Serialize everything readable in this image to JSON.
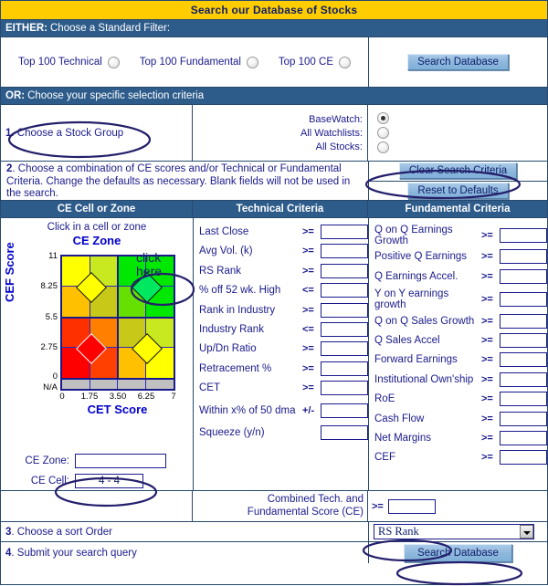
{
  "banner": {
    "title": "Search our Database of Stocks"
  },
  "standard_filter": {
    "header_bold": "EITHER:",
    "header_text": "Choose a Standard Filter:",
    "options": [
      {
        "label": "Top 100 Technical",
        "selected": false
      },
      {
        "label": "Top 100 Fundamental",
        "selected": false
      },
      {
        "label": "Top 100 CE",
        "selected": false
      }
    ],
    "search_button": "Search Database"
  },
  "specific_criteria": {
    "header_bold": "OR:",
    "header_text": "Choose your specific selection criteria"
  },
  "stock_group": {
    "step_number": "1",
    "step_text": ". Choose a Stock Group",
    "options": [
      {
        "label": "BaseWatch:",
        "selected": true
      },
      {
        "label": "All Watchlists:",
        "selected": false
      },
      {
        "label": "All Stocks:",
        "selected": false
      }
    ]
  },
  "instructions": {
    "step_number": "2",
    "step_text": ". Choose a combination of CE scores and/or Technical or Fundamental Criteria. Change the defaults as necessary. Blank fields will not be used in the search.",
    "clear_button": "Clear Search Criteria",
    "reset_button": "Reset to Defaults"
  },
  "column_headers": {
    "ce": "CE Cell or Zone",
    "technical": "Technical Criteria",
    "fundamental": "Fundamental Criteria"
  },
  "ce_panel": {
    "instruction": "Click in a cell or zone",
    "chart_title": "CE Zone",
    "y_axis_label": "CEF Score",
    "x_axis_label": "CET Score",
    "y_ticks": [
      "11",
      "8.25",
      "5.5",
      "2.75",
      "0",
      "N/A"
    ],
    "x_ticks": [
      "0",
      "1.75",
      "3.50",
      "6.25",
      "7"
    ],
    "click_here_line1": "click",
    "click_here_line2": "here",
    "ce_zone_label": "CE Zone:",
    "ce_zone_value": "",
    "ce_cell_label": "CE Cell:",
    "ce_cell_value": "4 - 4"
  },
  "chart_data": {
    "type": "heatmap",
    "title": "CE Zone",
    "xlabel": "CET Score",
    "ylabel": "CEF Score",
    "x_ticks": [
      "0",
      "1.75",
      "3.50",
      "6.25",
      "7"
    ],
    "y_ticks": [
      "11",
      "8.25",
      "5.5",
      "2.75",
      "0",
      "N/A"
    ],
    "rows": 4,
    "cols": 4,
    "cell_colors": [
      [
        "#ffff00",
        "#c8e820",
        "#00e800",
        "#00e800"
      ],
      [
        "#ffc000",
        "#c8c818",
        "#66e000",
        "#00e800"
      ],
      [
        "#ff3000",
        "#ff8000",
        "#c8c818",
        "#c8e820"
      ],
      [
        "#ff0000",
        "#ff4000",
        "#ffc000",
        "#ffff00"
      ]
    ],
    "na_row_color": "#c0c0c0",
    "zone_markers": [
      {
        "row": 0,
        "col": 1,
        "color": "#ffff00",
        "label": "zone-marker-top-left"
      },
      {
        "row": 0,
        "col": 2,
        "color": "#00e860",
        "label": "zone-marker-top-right"
      },
      {
        "row": 2,
        "col": 1,
        "color": "#ff0000",
        "label": "zone-marker-bottom-left"
      },
      {
        "row": 2,
        "col": 2,
        "color": "#ffff00",
        "label": "zone-marker-bottom-right"
      }
    ],
    "selected_cell": "4 - 4"
  },
  "technical_criteria": {
    "rows": [
      {
        "label": "Last Close",
        "op": ">=",
        "value": ""
      },
      {
        "label": "Avg Vol. (k)",
        "op": ">=",
        "value": ""
      },
      {
        "label": "RS Rank",
        "op": ">=",
        "value": ""
      },
      {
        "label": "% off 52 wk. High",
        "op": "<=",
        "value": ""
      },
      {
        "label": "Rank in Industry",
        "op": ">=",
        "value": ""
      },
      {
        "label": "Industry Rank",
        "op": "<=",
        "value": ""
      },
      {
        "label": "Up/Dn Ratio",
        "op": ">=",
        "value": ""
      },
      {
        "label": "Retracement %",
        "op": ">=",
        "value": ""
      },
      {
        "label": "CET",
        "op": ">=",
        "value": ""
      },
      {
        "label": "Within x% of 50 dma",
        "op": "+/-",
        "value": ""
      },
      {
        "label": "Squeeze (y/n)",
        "op": "",
        "value": ""
      }
    ]
  },
  "fundamental_criteria": {
    "rows": [
      {
        "label": "Q on Q Earnings Growth",
        "op": ">=",
        "value": ""
      },
      {
        "label": "Positive Q Earnings",
        "op": ">=",
        "value": ""
      },
      {
        "label": "Q Earnings Accel.",
        "op": ">=",
        "value": ""
      },
      {
        "label": "Y on Y earnings growth",
        "op": ">=",
        "value": ""
      },
      {
        "label": "Q on Q Sales Growth",
        "op": ">=",
        "value": ""
      },
      {
        "label": "Q Sales Accel",
        "op": ">=",
        "value": ""
      },
      {
        "label": "Forward Earnings",
        "op": ">=",
        "value": ""
      },
      {
        "label": "Institutional Own'ship",
        "op": ">=",
        "value": ""
      },
      {
        "label": "RoE",
        "op": ">=",
        "value": ""
      },
      {
        "label": "Cash Flow",
        "op": ">=",
        "value": ""
      },
      {
        "label": "Net Margins",
        "op": ">=",
        "value": ""
      },
      {
        "label": "CEF",
        "op": ">=",
        "value": ""
      }
    ]
  },
  "combined": {
    "label_line1": "Combined Tech. and",
    "label_line2": "Fundamental Score (CE)",
    "op": ">=",
    "value": ""
  },
  "sort_order": {
    "step_number": "3",
    "step_text": ". Choose a sort Order",
    "selected": "RS Rank"
  },
  "submit": {
    "step_number": "4",
    "step_text": ". Submit your search query",
    "button": "Search Database"
  }
}
